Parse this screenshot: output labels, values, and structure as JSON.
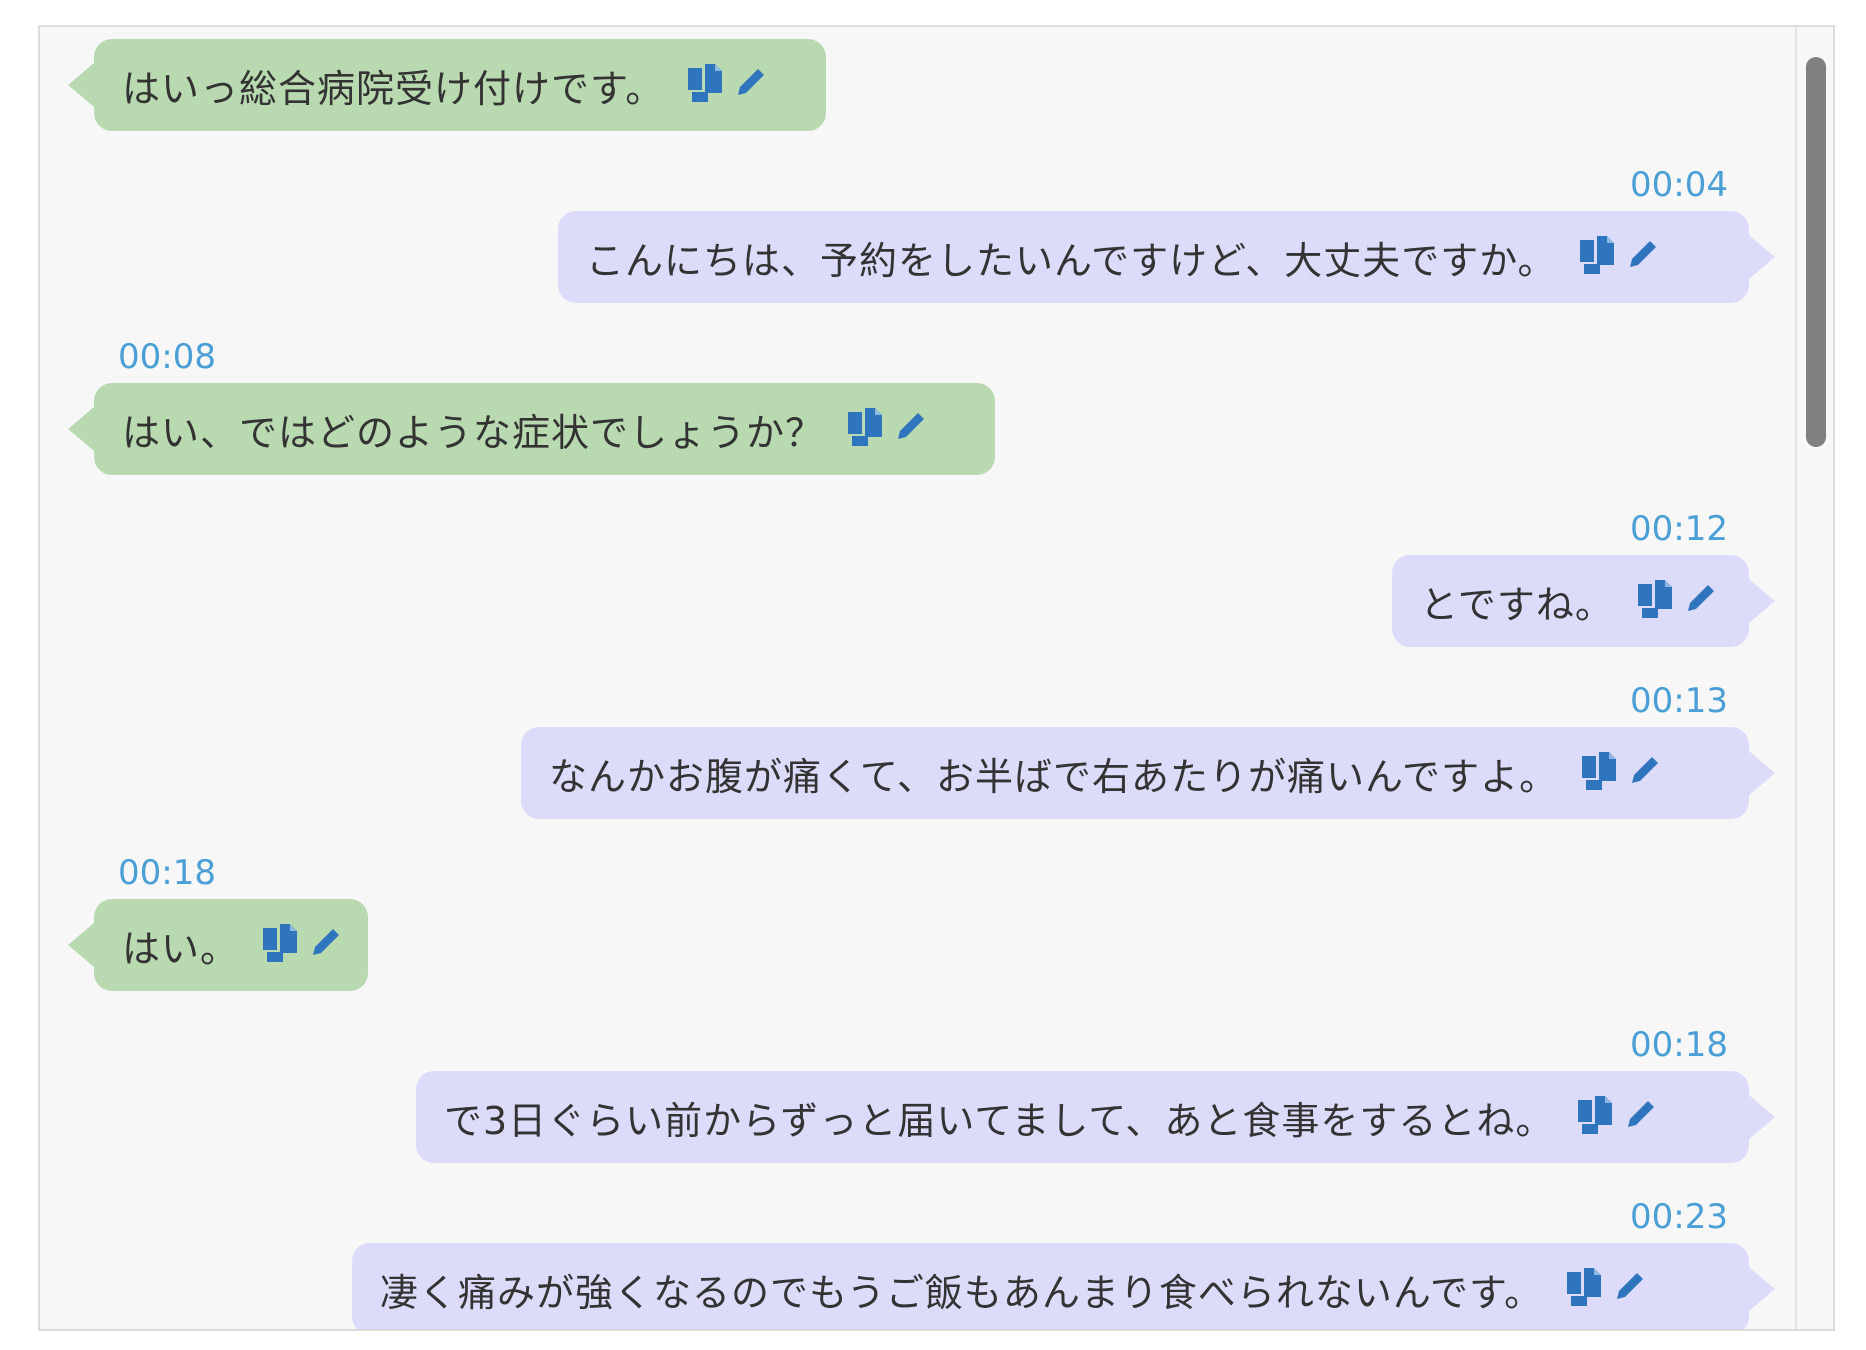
{
  "chat": {
    "messages": [
      {
        "side": "left",
        "time": "",
        "text": "はいっ総合病院受け付けです。"
      },
      {
        "side": "right",
        "time": "00:04",
        "text": "こんにちは、予約をしたいんですけど、大丈夫ですか。"
      },
      {
        "side": "left",
        "time": "00:08",
        "text": "はい、ではどのような症状でしょうか？"
      },
      {
        "side": "right",
        "time": "00:12",
        "text": "とですね。"
      },
      {
        "side": "right",
        "time": "00:13",
        "text": "なんかお腹が痛くて、お半ばで右あたりが痛いんですよ。"
      },
      {
        "side": "left",
        "time": "00:18",
        "text": "はい。"
      },
      {
        "side": "right",
        "time": "00:18",
        "text": "で3日ぐらい前からずっと届いてまして、あと食事をするとね。"
      },
      {
        "side": "right",
        "time": "00:23",
        "text": "凄く痛みが強くなるのでもうご飯もあんまり食べられないんです。"
      }
    ]
  },
  "icons": {
    "copy": "copy-icon",
    "edit": "pencil-icon"
  },
  "colors": {
    "left_bubble": "#b9d9b1",
    "right_bubble": "#dcdcfa",
    "timestamp": "#4a9fd6",
    "icon_blue": "#2f75bd",
    "background": "#f7f7f7"
  }
}
